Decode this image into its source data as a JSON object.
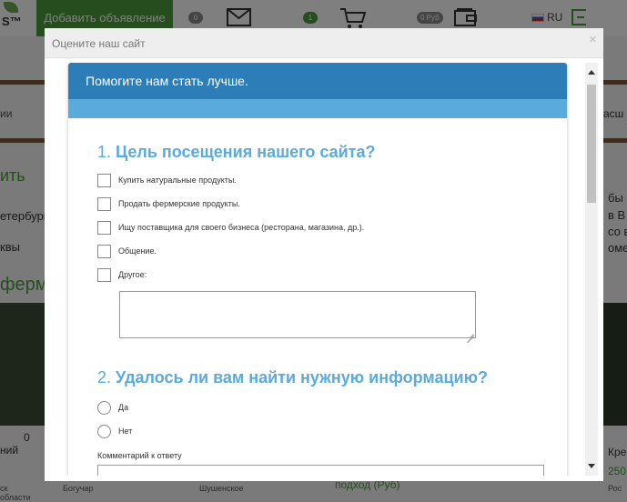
{
  "background": {
    "logo_text": "S™",
    "add_button": "Добавить объявление",
    "badges": [
      "0",
      "1",
      "0 Руб"
    ],
    "lang": "RU",
    "left_texts": [
      "ии",
      "ить",
      "етербург",
      "квы",
      "ферм",
      "ний",
      "0",
      "ск",
      "области"
    ],
    "right_texts": [
      "асш",
      "бы и",
      "в В",
      "со в",
      "омер",
      "Кре",
      "250",
      "Рос"
    ],
    "card_labels": [
      "Богучар",
      "Шушенское",
      "подход (Руб)"
    ]
  },
  "modal": {
    "title": "Оцените наш сайт",
    "close_glyph": "×"
  },
  "survey": {
    "header": "Помогите нам стать лучше.",
    "q1": {
      "number": "1.",
      "text": "Цель посещения нашего сайта?",
      "options": [
        "Купить натуральные продукты.",
        "Продать фермерские продукты.",
        "Ищу поставщика для своего бизнеса (ресторана, магазина, др.).",
        "Общение.",
        "Другое:"
      ]
    },
    "q2": {
      "number": "2.",
      "text": "Удалось ли вам найти нужную информацию?",
      "options": [
        "Да",
        "Нет"
      ],
      "comment_label": "Комментарий к ответу"
    }
  },
  "colors": {
    "accent_blue": "#2d7db8",
    "stripe_blue": "#5aabdc",
    "brand_green": "#4c9a3c"
  },
  "icons": [
    "mail-icon",
    "cart-icon",
    "wallet-icon",
    "exit-icon",
    "close-icon",
    "scroll-up-icon",
    "scroll-down-icon"
  ]
}
